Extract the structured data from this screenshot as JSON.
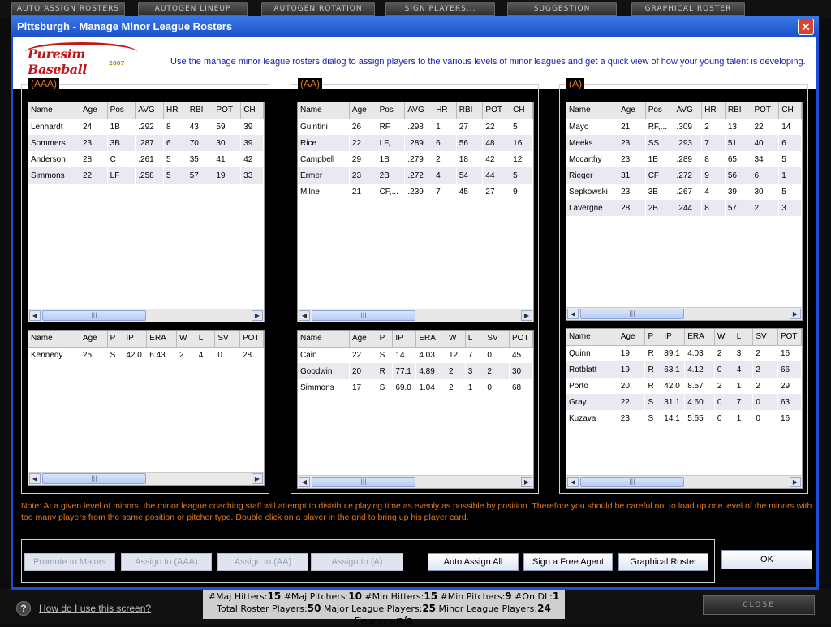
{
  "top_buttons": [
    "AUTO ASSIGN ROSTERS",
    "AUTOGEN LINEUP",
    "AUTOGEN ROTATION",
    "SIGN PLAYERS...",
    "SUGGESTION",
    "GRAPHICAL ROSTER"
  ],
  "dialog": {
    "title": "Pittsburgh - Manage Minor League Rosters",
    "close_icon": "close-icon",
    "logo_text": "Puresim Baseball",
    "logo_year": "2007",
    "header_text": "Use the manage minor league rosters dialog to assign players to the various levels of minor leagues and get a quick view of how your young talent is developing."
  },
  "levels": [
    {
      "label": "(AAA)",
      "hitter_headers": [
        "Name",
        "Age",
        "Pos",
        "AVG",
        "HR",
        "RBI",
        "POT",
        "CH"
      ],
      "hitters": [
        [
          "Lenhardt",
          "24",
          "1B",
          ".292",
          "8",
          "43",
          "59",
          "39"
        ],
        [
          "Sommers",
          "23",
          "3B",
          ".287",
          "6",
          "70",
          "30",
          "39"
        ],
        [
          "Anderson",
          "28",
          "C",
          ".261",
          "5",
          "35",
          "41",
          "42"
        ],
        [
          "Simmons",
          "22",
          "LF",
          ".258",
          "5",
          "57",
          "19",
          "33"
        ]
      ],
      "pitcher_headers": [
        "Name",
        "Age",
        "P",
        "IP",
        "ERA",
        "W",
        "L",
        "SV",
        "POT"
      ],
      "pitchers": [
        [
          "Kennedy",
          "25",
          "S",
          "42.0",
          "6.43",
          "2",
          "4",
          "0",
          "28"
        ]
      ]
    },
    {
      "label": "(AA)",
      "hitter_headers": [
        "Name",
        "Age",
        "Pos",
        "AVG",
        "HR",
        "RBI",
        "POT",
        "CH"
      ],
      "hitters": [
        [
          "Guintini",
          "26",
          "RF",
          ".298",
          "1",
          "27",
          "22",
          "5"
        ],
        [
          "Rice",
          "22",
          "LF,...",
          ".289",
          "6",
          "56",
          "48",
          "16"
        ],
        [
          "Campbell",
          "29",
          "1B",
          ".279",
          "2",
          "18",
          "42",
          "12"
        ],
        [
          "Ermer",
          "23",
          "2B",
          ".272",
          "4",
          "54",
          "44",
          "5"
        ],
        [
          "Milne",
          "21",
          "CF,...",
          ".239",
          "7",
          "45",
          "27",
          "9"
        ]
      ],
      "pitcher_headers": [
        "Name",
        "Age",
        "P",
        "IP",
        "ERA",
        "W",
        "L",
        "SV",
        "POT"
      ],
      "pitchers": [
        [
          "Cain",
          "22",
          "S",
          "14...",
          "4.03",
          "12",
          "7",
          "0",
          "45"
        ],
        [
          "Goodwin",
          "20",
          "R",
          "77.1",
          "4.89",
          "2",
          "3",
          "2",
          "30"
        ],
        [
          "Simmons",
          "17",
          "S",
          "69.0",
          "1.04",
          "2",
          "1",
          "0",
          "68"
        ]
      ]
    },
    {
      "label": "(A)",
      "hitter_headers": [
        "Name",
        "Age",
        "Pos",
        "AVG",
        "HR",
        "RBI",
        "POT",
        "CH"
      ],
      "hitters": [
        [
          "Mayo",
          "21",
          "RF,...",
          ".309",
          "2",
          "13",
          "22",
          "14"
        ],
        [
          "Meeks",
          "23",
          "SS",
          ".293",
          "7",
          "51",
          "40",
          "6"
        ],
        [
          "Mccarthy",
          "23",
          "1B",
          ".289",
          "8",
          "65",
          "34",
          "5"
        ],
        [
          "Rieger",
          "31",
          "CF",
          ".272",
          "9",
          "56",
          "6",
          "1"
        ],
        [
          "Sepkowski",
          "23",
          "3B",
          ".267",
          "4",
          "39",
          "30",
          "5"
        ],
        [
          "Lavergne",
          "28",
          "2B",
          ".244",
          "8",
          "57",
          "2",
          "3"
        ]
      ],
      "pitcher_headers": [
        "Name",
        "Age",
        "P",
        "IP",
        "ERA",
        "W",
        "L",
        "SV",
        "POT"
      ],
      "pitchers": [
        [
          "Quinn",
          "19",
          "R",
          "89.1",
          "4.03",
          "2",
          "3",
          "2",
          "16"
        ],
        [
          "Rotblatt",
          "19",
          "R",
          "63.1",
          "4.12",
          "0",
          "4",
          "2",
          "66"
        ],
        [
          "Porto",
          "20",
          "R",
          "42.0",
          "8.57",
          "2",
          "1",
          "2",
          "29"
        ],
        [
          "Gray",
          "22",
          "S",
          "31.1",
          "4.60",
          "0",
          "7",
          "0",
          "63"
        ],
        [
          "Kuzava",
          "23",
          "S",
          "14.1",
          "5.65",
          "0",
          "1",
          "0",
          "16"
        ]
      ]
    }
  ],
  "note": "Note: At a given level of minors, the minor league coaching staff will attempt to distribute playing time as evenly as possible by position.  Therefore you should be careful not to load up one level of the minors with too many players from the same position or pitcher type.  Double click on a player in the grid to bring up his player card.",
  "buttons": {
    "promote": "Promote to Majors",
    "assign_aaa": "Assign to (AAA)",
    "assign_aa": "Assign to (AA)",
    "assign_a": "Assign to (A)",
    "auto_assign": "Auto Assign All",
    "sign_free_agent": "Sign a Free Agent",
    "graphical_roster": "Graphical Roster",
    "ok": "OK"
  },
  "stats": {
    "maj_hitters_label": "#Maj Hitters:",
    "maj_hitters": "15",
    "maj_pitchers_label": "#Maj Pitchers:",
    "maj_pitchers": "10",
    "min_hitters_label": "#Min Hitters:",
    "min_hitters": "15",
    "min_pitchers_label": "#Min Pitchers:",
    "min_pitchers": "9",
    "on_dl_label": "#On DL:",
    "on_dl": "1",
    "total_label": "Total Roster Players:",
    "total": "50",
    "major_label": "Major League Players:",
    "major": "25",
    "minor_label": "Minor League Players:",
    "minor": "24",
    "finances_label": "Finances:",
    "finances": "n/a"
  },
  "help_link": "How do I use this screen?",
  "close_label": "CLOSE"
}
